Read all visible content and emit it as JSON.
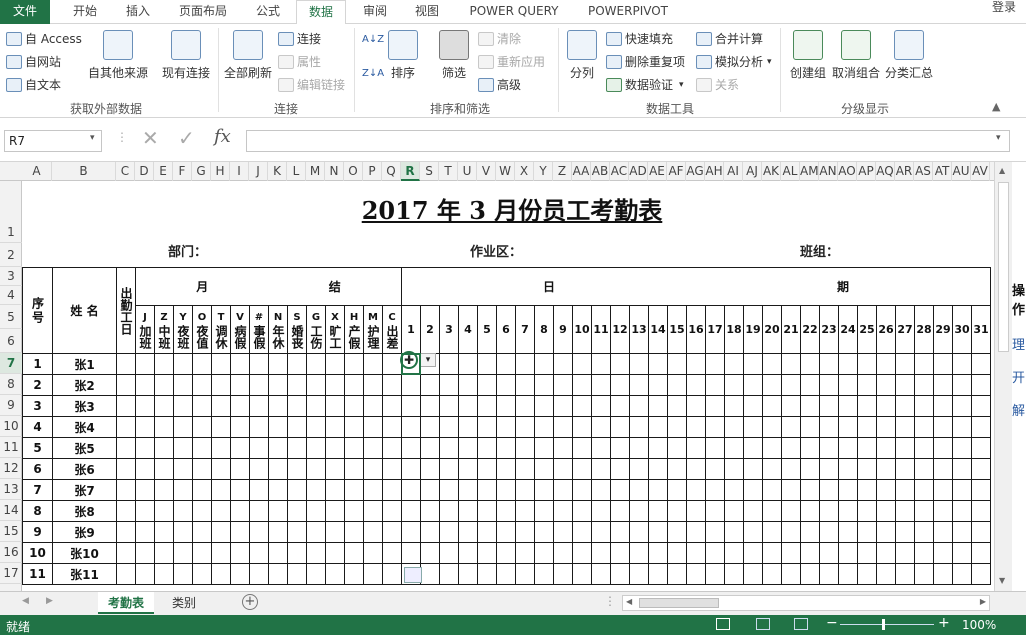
{
  "ribbon": {
    "tabs": [
      "文件",
      "开始",
      "插入",
      "页面布局",
      "公式",
      "数据",
      "审阅",
      "视图",
      "POWER QUERY",
      "POWERPIVOT"
    ],
    "login": "登录",
    "groups": {
      "external": {
        "label": "获取外部数据",
        "items": [
          "自 Access",
          "自网站",
          "自文本"
        ],
        "other": "自其他来源",
        "existing": "现有连接"
      },
      "connections": {
        "label": "连接",
        "refresh": "全部刷新",
        "items": [
          "连接",
          "属性",
          "编辑链接"
        ]
      },
      "sort": {
        "label": "排序和筛选",
        "sort": "排序",
        "filter": "筛选",
        "items": [
          "清除",
          "重新应用",
          "高级"
        ]
      },
      "tools": {
        "label": "数据工具",
        "split": "分列",
        "items": [
          "快速填充",
          "删除重复项",
          "数据验证"
        ],
        "items2": [
          "合并计算",
          "模拟分析",
          "关系"
        ]
      },
      "outline": {
        "label": "分级显示",
        "items": [
          "创建组",
          "取消组合",
          "分类汇总"
        ]
      }
    }
  },
  "formula_bar": {
    "name_box": "R7",
    "fx": "fx"
  },
  "columns": [
    "A",
    "B",
    "C",
    "D",
    "E",
    "F",
    "G",
    "H",
    "I",
    "J",
    "K",
    "L",
    "M",
    "N",
    "O",
    "P",
    "Q",
    "R",
    "S",
    "T",
    "U",
    "V",
    "W",
    "X",
    "Y",
    "Z",
    "AA",
    "AB",
    "AC",
    "AD",
    "AE",
    "AF",
    "AG",
    "AH",
    "AI",
    "AJ",
    "AK",
    "AL",
    "AM",
    "AN",
    "AO",
    "AP",
    "AQ",
    "AR",
    "AS",
    "AT",
    "AU",
    "AV"
  ],
  "rows": [
    "1",
    "2",
    "3",
    "4",
    "5",
    "6",
    "7",
    "8",
    "9",
    "10",
    "11",
    "12",
    "13",
    "14",
    "15",
    "16",
    "17"
  ],
  "sheet": {
    "title": "2017 年 3 月份员工考勤表",
    "dept": "部门：",
    "area": "作业区：",
    "team": "班组：",
    "seq": "序号",
    "name": "姓  名",
    "days_work": "出勤工日",
    "month_label": "月",
    "settle_label": "结",
    "day_label": "日",
    "period_label": "期",
    "codes": [
      [
        "J",
        "加班"
      ],
      [
        "Z",
        "中班"
      ],
      [
        "Y",
        "夜班"
      ],
      [
        "O",
        "夜值"
      ],
      [
        "T",
        "调休"
      ],
      [
        "V",
        "病假"
      ],
      [
        "#",
        "事假"
      ],
      [
        "N",
        "年休"
      ],
      [
        "S",
        "婚丧"
      ],
      [
        "G",
        "工伤"
      ],
      [
        "X",
        "旷工"
      ],
      [
        "H",
        "产假"
      ],
      [
        "M",
        "护理"
      ],
      [
        "C",
        "出差"
      ]
    ],
    "days": [
      "1",
      "2",
      "3",
      "4",
      "5",
      "6",
      "7",
      "8",
      "9",
      "10",
      "11",
      "12",
      "13",
      "14",
      "15",
      "16",
      "17",
      "18",
      "19",
      "20",
      "21",
      "22",
      "23",
      "24",
      "25",
      "26",
      "27",
      "28",
      "29",
      "30",
      "31"
    ],
    "employees": [
      [
        "1",
        "张1"
      ],
      [
        "2",
        "张2"
      ],
      [
        "3",
        "张3"
      ],
      [
        "4",
        "张4"
      ],
      [
        "5",
        "张5"
      ],
      [
        "6",
        "张6"
      ],
      [
        "7",
        "张7"
      ],
      [
        "8",
        "张8"
      ],
      [
        "9",
        "张9"
      ],
      [
        "10",
        "张10"
      ],
      [
        "11",
        "张11"
      ]
    ]
  },
  "sheet_tabs": [
    "考勤表",
    "类别"
  ],
  "status": {
    "ready": "就绪",
    "zoom": "100%"
  },
  "side_panel": [
    "操作",
    "理",
    "开",
    "解"
  ]
}
